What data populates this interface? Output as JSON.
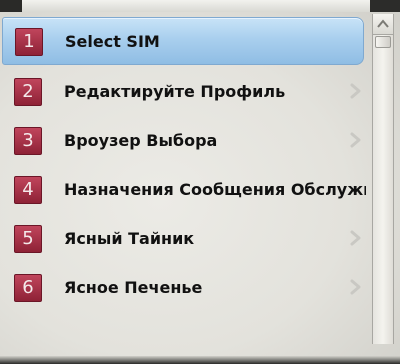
{
  "menu": {
    "items": [
      {
        "number": "1",
        "label": "Select SIM",
        "selected": true
      },
      {
        "number": "2",
        "label": "Редактируйте Профиль",
        "selected": false
      },
      {
        "number": "3",
        "label": "Вроузер Выбора",
        "selected": false
      },
      {
        "number": "4",
        "label": "Назначения Сообщения Обслужи",
        "selected": false
      },
      {
        "number": "5",
        "label": "Ясный Тайник",
        "selected": false
      },
      {
        "number": "6",
        "label": "Ясное Печенье",
        "selected": false
      }
    ]
  },
  "icons": {
    "item_arrow": "chevron-right-icon",
    "scroll_up": "scroll-up-arrow-icon"
  },
  "colors": {
    "highlight": "#a9cfee",
    "number_badge": "#a8354a",
    "text": "#111111"
  }
}
